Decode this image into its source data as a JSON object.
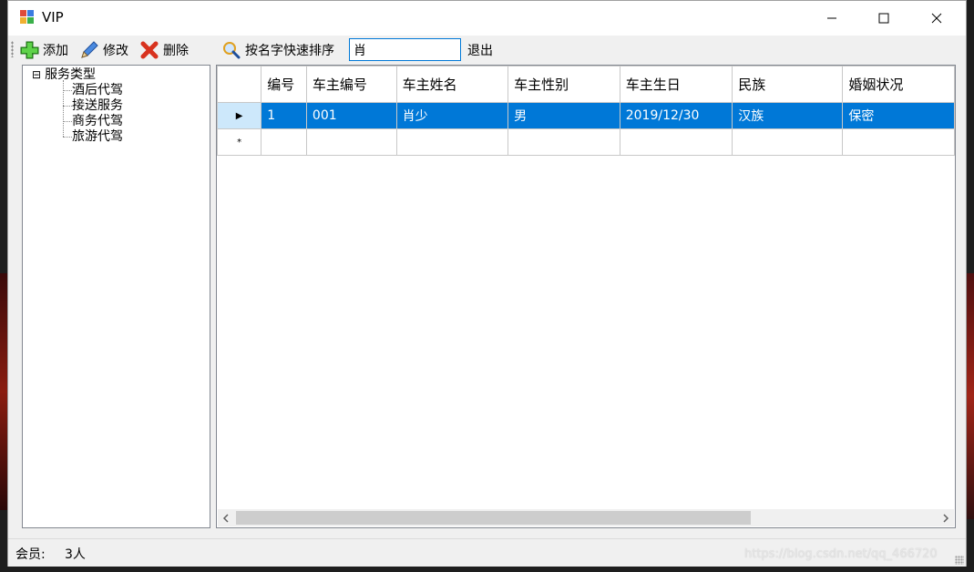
{
  "window": {
    "title": "VIP"
  },
  "toolbar": {
    "add_label": "添加",
    "edit_label": "修改",
    "delete_label": "删除",
    "sort_label": "按名字快速排序",
    "search_value": "肖",
    "exit_label": "退出"
  },
  "tree": {
    "root_toggle": "⊟",
    "root": "服务类型",
    "children": [
      "酒后代驾",
      "接送服务",
      "商务代驾",
      "旅游代驾"
    ]
  },
  "grid": {
    "columns": [
      "编号",
      "车主编号",
      "车主姓名",
      "车主性别",
      "车主生日",
      "民族",
      "婚姻状况"
    ],
    "rows": [
      {
        "indicator": "▶",
        "cells": [
          "1",
          "001",
          "肖少",
          "男",
          "2019/12/30",
          "汉族",
          "保密"
        ]
      }
    ],
    "new_row_indicator": "*"
  },
  "status": {
    "label": "会员:",
    "value": "3人"
  },
  "watermark": "https://blog.csdn.net/qq_466720"
}
